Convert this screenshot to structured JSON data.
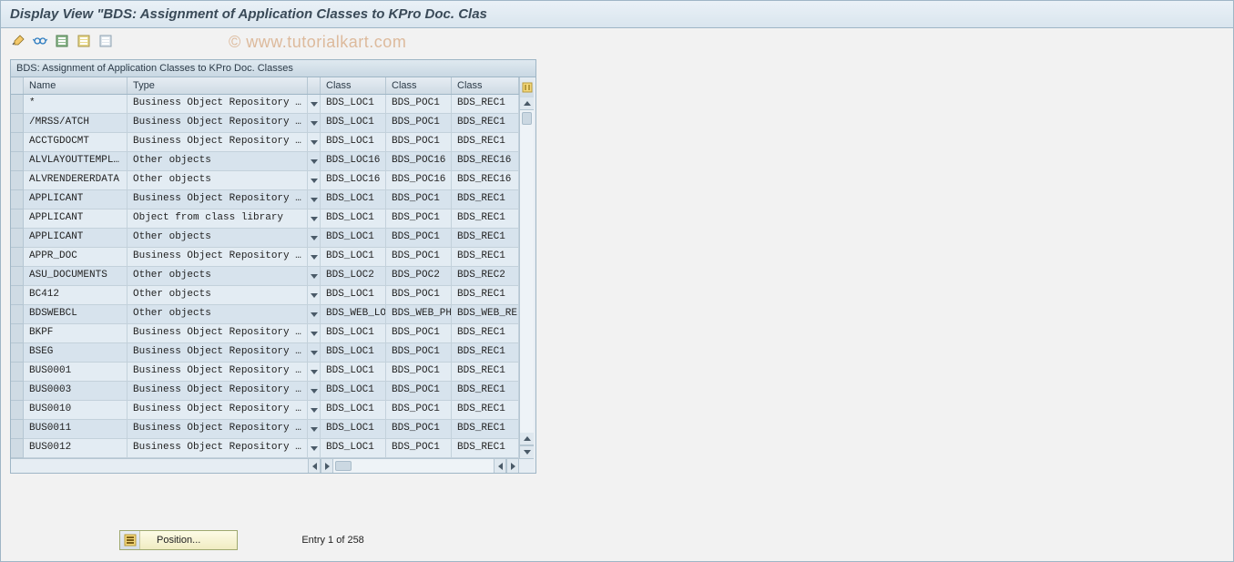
{
  "title": "Display View \"BDS: Assignment of Application Classes to KPro Doc. Clas",
  "watermark": "© www.tutorialkart.com",
  "grid": {
    "caption": "BDS: Assignment of Application Classes to KPro Doc. Classes",
    "headers": {
      "name": "Name",
      "type": "Type",
      "c1": "Class",
      "c2": "Class",
      "c3": "Class"
    },
    "rows": [
      {
        "name": "*",
        "type": "Business Object Repository …",
        "c1": "BDS_LOC1",
        "c2": "BDS_POC1",
        "c3": "BDS_REC1"
      },
      {
        "name": "/MRSS/ATCH",
        "type": "Business Object Repository …",
        "c1": "BDS_LOC1",
        "c2": "BDS_POC1",
        "c3": "BDS_REC1"
      },
      {
        "name": "ACCTGDOCMT",
        "type": "Business Object Repository …",
        "c1": "BDS_LOC1",
        "c2": "BDS_POC1",
        "c3": "BDS_REC1"
      },
      {
        "name": "ALVLAYOUTTEMPL…",
        "type": "Other objects",
        "c1": "BDS_LOC16",
        "c2": "BDS_POC16",
        "c3": "BDS_REC16"
      },
      {
        "name": "ALVRENDERERDATA",
        "type": "Other objects",
        "c1": "BDS_LOC16",
        "c2": "BDS_POC16",
        "c3": "BDS_REC16"
      },
      {
        "name": "APPLICANT",
        "type": "Business Object Repository …",
        "c1": "BDS_LOC1",
        "c2": "BDS_POC1",
        "c3": "BDS_REC1"
      },
      {
        "name": "APPLICANT",
        "type": "Object from class library",
        "c1": "BDS_LOC1",
        "c2": "BDS_POC1",
        "c3": "BDS_REC1"
      },
      {
        "name": "APPLICANT",
        "type": "Other objects",
        "c1": "BDS_LOC1",
        "c2": "BDS_POC1",
        "c3": "BDS_REC1"
      },
      {
        "name": "APPR_DOC",
        "type": "Business Object Repository …",
        "c1": "BDS_LOC1",
        "c2": "BDS_POC1",
        "c3": "BDS_REC1"
      },
      {
        "name": "ASU_DOCUMENTS",
        "type": "Other objects",
        "c1": "BDS_LOC2",
        "c2": "BDS_POC2",
        "c3": "BDS_REC2"
      },
      {
        "name": "BC412",
        "type": "Other objects",
        "c1": "BDS_LOC1",
        "c2": "BDS_POC1",
        "c3": "BDS_REC1"
      },
      {
        "name": "BDSWEBCL",
        "type": "Other objects",
        "c1": "BDS_WEB_LO",
        "c2": "BDS_WEB_PH",
        "c3": "BDS_WEB_RE"
      },
      {
        "name": "BKPF",
        "type": "Business Object Repository …",
        "c1": "BDS_LOC1",
        "c2": "BDS_POC1",
        "c3": "BDS_REC1"
      },
      {
        "name": "BSEG",
        "type": "Business Object Repository …",
        "c1": "BDS_LOC1",
        "c2": "BDS_POC1",
        "c3": "BDS_REC1"
      },
      {
        "name": "BUS0001",
        "type": "Business Object Repository …",
        "c1": "BDS_LOC1",
        "c2": "BDS_POC1",
        "c3": "BDS_REC1"
      },
      {
        "name": "BUS0003",
        "type": "Business Object Repository …",
        "c1": "BDS_LOC1",
        "c2": "BDS_POC1",
        "c3": "BDS_REC1"
      },
      {
        "name": "BUS0010",
        "type": "Business Object Repository …",
        "c1": "BDS_LOC1",
        "c2": "BDS_POC1",
        "c3": "BDS_REC1"
      },
      {
        "name": "BUS0011",
        "type": "Business Object Repository …",
        "c1": "BDS_LOC1",
        "c2": "BDS_POC1",
        "c3": "BDS_REC1"
      },
      {
        "name": "BUS0012",
        "type": "Business Object Repository …",
        "c1": "BDS_LOC1",
        "c2": "BDS_POC1",
        "c3": "BDS_REC1"
      }
    ]
  },
  "footer": {
    "position_label": "Position...",
    "entry_text": "Entry 1 of 258"
  },
  "toolbar_icons": [
    "glasses-pencil-icon",
    "glasses-icon",
    "bounds-icon",
    "bounds2-icon",
    "bounds3-icon"
  ]
}
